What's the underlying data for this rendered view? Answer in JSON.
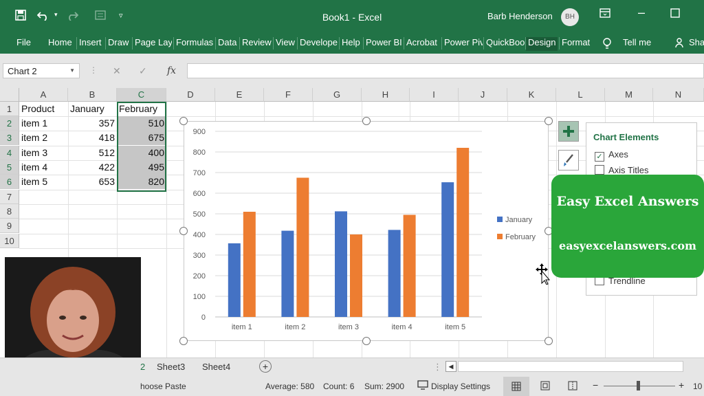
{
  "app": {
    "title": "Book1  -  Excel",
    "user_name": "Barb Henderson",
    "user_initials": "BH",
    "accent": "#217346"
  },
  "ribbon": {
    "tabs": [
      "File",
      "Home",
      "Insert",
      "Draw",
      "Page Layo",
      "Formulas",
      "Data",
      "Review",
      "View",
      "Develope",
      "Help",
      "Power BI",
      "Acrobat",
      "Power Piv",
      "QuickBoo",
      "Design",
      "Format"
    ],
    "active_tab": "Design",
    "tell_me": "Tell me",
    "share": "Sha"
  },
  "formula_bar": {
    "name_box": "Chart 2",
    "fx": "fx",
    "formula": ""
  },
  "grid": {
    "columns": [
      "A",
      "B",
      "C",
      "D",
      "E",
      "F",
      "G",
      "H",
      "I",
      "J",
      "K",
      "L",
      "M",
      "N"
    ],
    "rows": [
      "1",
      "2",
      "3",
      "4",
      "5",
      "6",
      "7",
      "8",
      "9",
      "10"
    ],
    "header": [
      "Product",
      "January",
      "February"
    ],
    "data": [
      [
        "item 1",
        "357",
        "510"
      ],
      [
        "item 2",
        "418",
        "675"
      ],
      [
        "item 3",
        "512",
        "400"
      ],
      [
        "item 4",
        "422",
        "495"
      ],
      [
        "item 5",
        "653",
        "820"
      ]
    ]
  },
  "chart_data": {
    "type": "bar",
    "categories": [
      "item 1",
      "item 2",
      "item 3",
      "item 4",
      "item 5"
    ],
    "series": [
      {
        "name": "January",
        "values": [
          357,
          418,
          512,
          422,
          653
        ],
        "color": "#4472c4"
      },
      {
        "name": "February",
        "values": [
          510,
          675,
          400,
          495,
          820
        ],
        "color": "#ed7d31"
      }
    ],
    "yticks": [
      "0",
      "100",
      "200",
      "300",
      "400",
      "500",
      "600",
      "700",
      "800",
      "900"
    ],
    "ylim": [
      0,
      900
    ],
    "grid": true,
    "legend_position": "right"
  },
  "chart_elements": {
    "title": "Chart Elements",
    "items": [
      {
        "label": "Axes",
        "checked": true
      },
      {
        "label": "Axis Titles",
        "checked": false
      },
      {
        "label": "Trendline",
        "checked": false
      }
    ]
  },
  "brand": {
    "name": "Easy Excel Answers",
    "url": "easyexcelanswers.com",
    "color": "#2aa63a"
  },
  "sheets": {
    "tabs": [
      "Sheet3",
      "Sheet4"
    ],
    "partial_tab": "2",
    "add": "+"
  },
  "status": {
    "mode": "hoose Paste",
    "average": "Average: 580",
    "count": "Count: 6",
    "sum": "Sum: 2900",
    "display_settings": "Display Settings",
    "zoom_minus": "−",
    "zoom_plus": "+",
    "zoom": "10"
  }
}
